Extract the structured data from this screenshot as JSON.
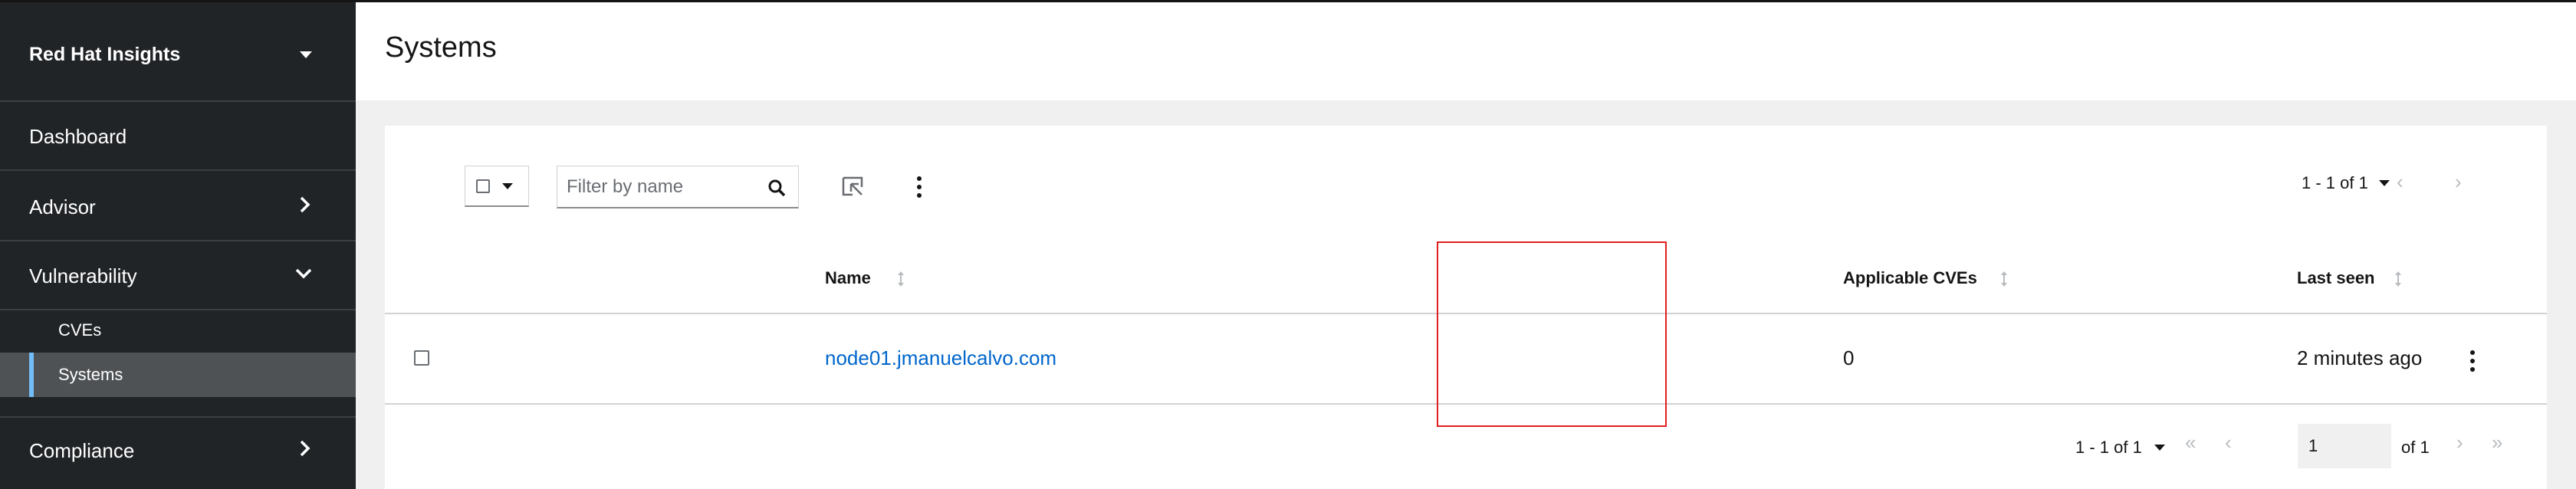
{
  "sidebar": {
    "brand": "Red Hat Insights",
    "items": [
      {
        "label": "Dashboard"
      },
      {
        "label": "Advisor"
      },
      {
        "label": "Vulnerability"
      },
      {
        "label": "Compliance"
      }
    ],
    "sub_items": [
      {
        "label": "CVEs"
      },
      {
        "label": "Systems",
        "active": true
      }
    ]
  },
  "page": {
    "title": "Systems"
  },
  "toolbar": {
    "filter_placeholder": "Filter by name",
    "pagination_label": "1 - 1 of 1"
  },
  "table": {
    "columns": [
      "Name",
      "Applicable CVEs",
      "Last seen"
    ],
    "rows": [
      {
        "name": "node01.jmanuelcalvo.com",
        "applicable_cves": "0",
        "last_seen": "2 minutes ago"
      }
    ]
  },
  "pagination": {
    "range_label": "1 - 1 of 1",
    "current_page": "1",
    "of_label": "of 1"
  },
  "colors": {
    "sidebar_bg": "#212427",
    "active_bg": "#4f5255",
    "active_accent": "#73bcf7",
    "link": "#0066cc",
    "highlight": "#e02020"
  }
}
